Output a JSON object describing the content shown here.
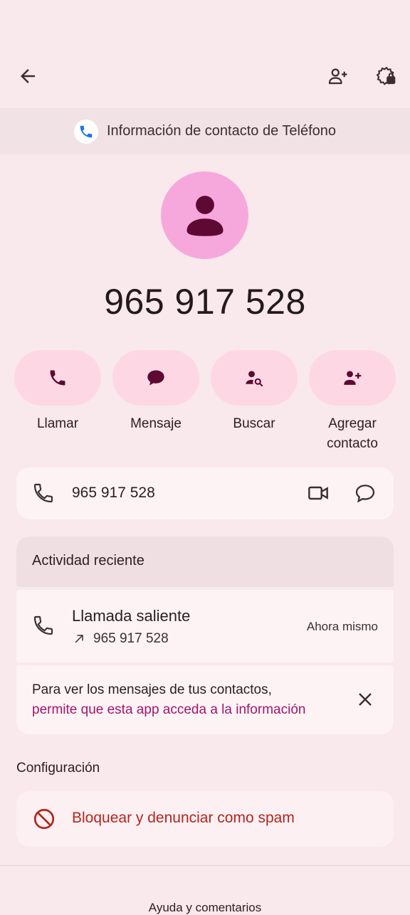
{
  "banner": {
    "text": "Información de contacto de Teléfono"
  },
  "contact": {
    "number": "965 917 528"
  },
  "actions": [
    {
      "label": "Llamar"
    },
    {
      "label": "Mensaje"
    },
    {
      "label": "Buscar"
    },
    {
      "label_line1": "Agregar",
      "label_line2": "contacto"
    }
  ],
  "number_card": {
    "number": "965 917 528"
  },
  "recent": {
    "header": "Actividad reciente",
    "item": {
      "title": "Llamada saliente",
      "number": "965 917 528",
      "time": "Ahora mismo"
    }
  },
  "permission": {
    "line1": "Para ver los mensajes de tus contactos,",
    "link": "permite que esta app acceda a la información"
  },
  "settings": {
    "title": "Configuración",
    "block_label": "Bloquear y denunciar como spam"
  },
  "footer": {
    "help": "Ayuda y comentarios"
  },
  "colors": {
    "accent": "#a1166c",
    "danger": "#b3261e",
    "pill": "#fdd8e4",
    "avatar": "#f6a8dc"
  }
}
